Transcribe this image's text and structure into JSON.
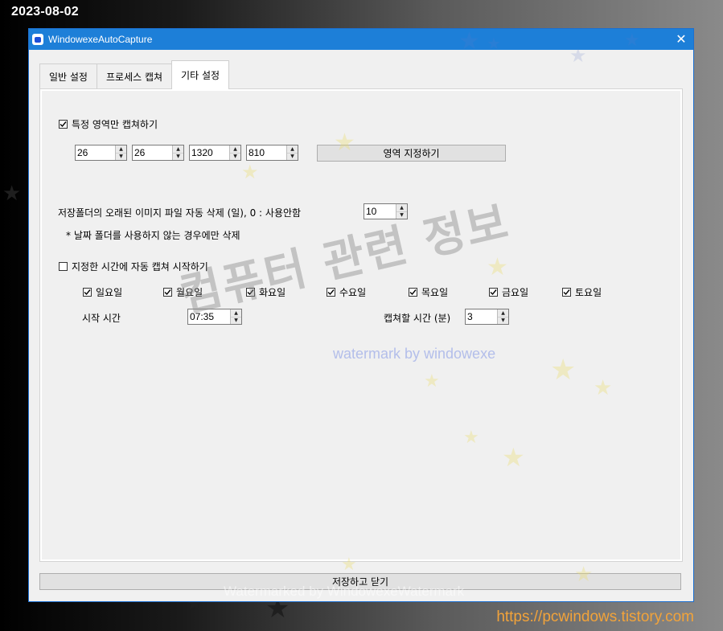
{
  "overlay": {
    "date": "2023-08-02",
    "url": "https://pcwindows.tistory.com",
    "watermark_korean": "컴퓨터 관련 정보",
    "watermark_english": "watermark by windowexe",
    "watermark_bottom": "Watermarked by WindowexeWatermark"
  },
  "window": {
    "title": "WindowexeAutoCapture",
    "close_symbol": "✕"
  },
  "tabs": [
    {
      "label": "일반 설정",
      "active": false
    },
    {
      "label": "프로세스 캡쳐",
      "active": false
    },
    {
      "label": "기타 설정",
      "active": true
    }
  ],
  "region_capture": {
    "checkbox_label": "특정 영역만 캡쳐하기",
    "checked": true,
    "values": [
      "26",
      "26",
      "1320",
      "810"
    ],
    "set_region_button": "영역 지정하기"
  },
  "auto_delete": {
    "label": "저장폴더의 오래된 이미지 파일 자동 삭제 (일), 0 : 사용안함",
    "value": "10",
    "note": "* 날짜 폴더를 사용하지 않는 경우에만 삭제"
  },
  "scheduled_capture": {
    "checkbox_label": "지정한 시간에 자동 캡쳐 시작하기",
    "checked": false,
    "days": [
      {
        "label": "일요일",
        "checked": true
      },
      {
        "label": "월요일",
        "checked": true
      },
      {
        "label": "화요일",
        "checked": true
      },
      {
        "label": "수요일",
        "checked": true
      },
      {
        "label": "목요일",
        "checked": true
      },
      {
        "label": "금요일",
        "checked": true
      },
      {
        "label": "토요일",
        "checked": true
      }
    ],
    "start_time_label": "시작 시간",
    "start_time_value": "07:35",
    "duration_label": "캡쳐할 시간 (분)",
    "duration_value": "3"
  },
  "footer": {
    "save_close_button": "저장하고 닫기"
  },
  "icons": {
    "check": "check-icon",
    "spin_up": "▲",
    "spin_down": "▼"
  },
  "colors": {
    "titlebar": "#1d7fd8",
    "url": "#f2a33a"
  }
}
